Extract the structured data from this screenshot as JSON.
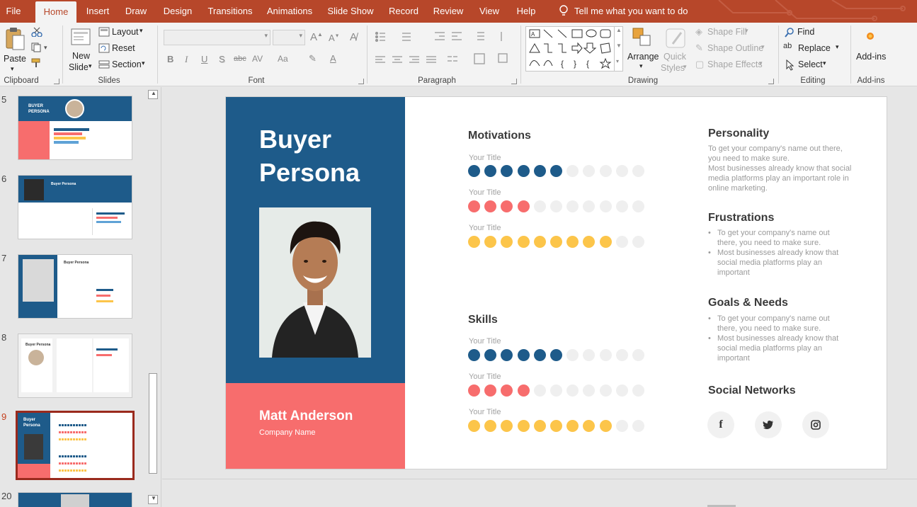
{
  "tabs": [
    "File",
    "Home",
    "Insert",
    "Draw",
    "Design",
    "Transitions",
    "Animations",
    "Slide Show",
    "Record",
    "Review",
    "View",
    "Help"
  ],
  "active_tab": "Home",
  "tell_me": "Tell me what you want to do",
  "ribbon": {
    "clipboard": {
      "paste": "Paste",
      "label": "Clipboard"
    },
    "slides": {
      "new_slide_1": "New",
      "new_slide_2": "Slide",
      "layout": "Layout",
      "reset": "Reset",
      "section": "Section",
      "label": "Slides"
    },
    "font": {
      "label": "Font",
      "bold": "B",
      "italic": "I",
      "underline": "U",
      "shadow": "S",
      "strike": "abc",
      "spacing": "AV",
      "case": "Aa"
    },
    "paragraph": {
      "label": "Paragraph"
    },
    "drawing": {
      "arrange": "Arrange",
      "quick_styles_1": "Quick",
      "quick_styles_2": "Styles",
      "shape_fill": "Shape Fill",
      "shape_outline": "Shape Outline",
      "shape_effects": "Shape Effects",
      "label": "Drawing"
    },
    "editing": {
      "find": "Find",
      "replace": "Replace",
      "select": "Select",
      "label": "Editing"
    },
    "addins": {
      "button": "Add-ins",
      "label": "Add-ins"
    }
  },
  "slide_numbers": [
    "5",
    "6",
    "7",
    "8",
    "9",
    "20"
  ],
  "selected_slide": "9",
  "thumbs": {
    "t5_title_1": "BUYER",
    "t5_title_2": "PERSONA",
    "t6_title": "Buyer Persona",
    "t7_title": "Buyer Persona",
    "t8_title": "Buyer Persona",
    "t9_title_1": "Buyer",
    "t9_title_2": "Persona"
  },
  "slide": {
    "title_line1": "Buyer",
    "title_line2": "Persona",
    "name": "Matt Anderson",
    "company": "Company Name",
    "motivations": {
      "heading": "Motivations",
      "rows": [
        {
          "label": "Your Title",
          "filled": 6,
          "total": 11,
          "color": "#1e5b8a"
        },
        {
          "label": "Your Title",
          "filled": 4,
          "total": 11,
          "color": "#f76d6d"
        },
        {
          "label": "Your Title",
          "filled": 9,
          "total": 11,
          "color": "#fcc54a"
        }
      ]
    },
    "skills": {
      "heading": "Skills",
      "rows": [
        {
          "label": "Your Title",
          "filled": 6,
          "total": 11,
          "color": "#1e5b8a"
        },
        {
          "label": "Your Title",
          "filled": 4,
          "total": 11,
          "color": "#f76d6d"
        },
        {
          "label": "Your Title",
          "filled": 9,
          "total": 11,
          "color": "#fcc54a"
        }
      ]
    },
    "personality": {
      "heading": "Personality",
      "text1": "To get your company's name out there, you need to make sure.",
      "text2": "Most businesses already know that social media platforms play an important role in online marketing."
    },
    "frustrations": {
      "heading": "Frustrations",
      "items": [
        "To get your company's name out there, you need to make sure.",
        "Most businesses already know that social media platforms play an important"
      ]
    },
    "goals": {
      "heading": "Goals & Needs",
      "items": [
        "To get your company's name out there, you need to make sure.",
        "Most businesses already know that social media platforms play an important"
      ]
    },
    "social": {
      "heading": "Social Networks",
      "facebook": "f"
    }
  },
  "colors": {
    "accent": "#b7472a",
    "navy": "#1e5b8a",
    "coral": "#f76d6d",
    "yellow": "#fcc54a",
    "empty_dot": "#efefef"
  }
}
